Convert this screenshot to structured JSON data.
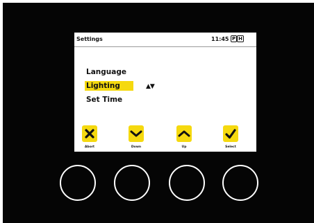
{
  "header": {
    "title": "Settings",
    "time": "11:45",
    "mode_icons": [
      "P",
      "H"
    ]
  },
  "menu": {
    "items": [
      {
        "label": "Language",
        "selected": false
      },
      {
        "label": "Lighting",
        "selected": true
      },
      {
        "label": "Set Time",
        "selected": false
      }
    ],
    "scroll_indicator": "▲▼"
  },
  "softkeys": [
    {
      "label": "Abort",
      "icon": "x-icon"
    },
    {
      "label": "Down",
      "icon": "chevron-down-icon"
    },
    {
      "label": "Up",
      "icon": "chevron-up-icon"
    },
    {
      "label": "Select",
      "icon": "checkmark-icon"
    }
  ],
  "colors": {
    "accent": "#f5d90f",
    "bezel": "#050505",
    "screen": "#ffffff"
  }
}
